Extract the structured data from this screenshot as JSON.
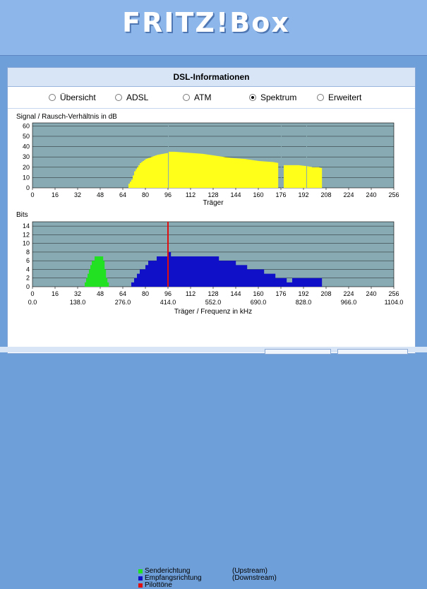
{
  "brand": {
    "logo_text": "FRITZ!Box"
  },
  "page": {
    "title": "DSL-Informationen"
  },
  "tabs": [
    {
      "label": "Übersicht",
      "selected": false
    },
    {
      "label": "ADSL",
      "selected": false
    },
    {
      "label": "ATM",
      "selected": false
    },
    {
      "label": "Spektrum",
      "selected": true
    },
    {
      "label": "Erweitert",
      "selected": false
    }
  ],
  "legend": {
    "rows": [
      {
        "label": "Senderichtung",
        "dir": "(Upstream)",
        "color": "#22e022"
      },
      {
        "label": "Empfangsrichtung",
        "dir": "(Downstream)",
        "color": "#1010c8"
      },
      {
        "label": "Pilottöne",
        "dir": "",
        "color": "#e01010"
      }
    ]
  },
  "chart_data": [
    {
      "type": "bar",
      "title": "Signal / Rausch-Verhältnis in dB",
      "xlabel": "Träger",
      "ylabel": "",
      "xlim": [
        0,
        256
      ],
      "ylim": [
        0,
        63
      ],
      "x_ticks": [
        0,
        16,
        32,
        48,
        64,
        80,
        96,
        112,
        128,
        144,
        160,
        176,
        192,
        208,
        224,
        240,
        256
      ],
      "y_ticks": [
        0,
        10,
        20,
        30,
        40,
        50,
        60
      ],
      "grid": true,
      "series": [
        {
          "color": "#ffff1a",
          "segments": [
            {
              "x": [
                68,
                70,
                72,
                74,
                76,
                80,
                84,
                88,
                92,
                96
              ],
              "y": [
                4,
                8,
                16,
                20,
                24,
                28,
                30,
                32,
                33,
                34
              ]
            },
            {
              "x": [
                96,
                100,
                110,
                120,
                130,
                140,
                150,
                160,
                170,
                174
              ],
              "y": [
                35,
                35,
                34,
                33,
                31,
                29,
                28,
                26,
                25,
                24
              ]
            },
            {
              "x": [
                178,
                182,
                188,
                194,
                198,
                202,
                205
              ],
              "y": [
                22,
                22,
                22,
                21,
                20,
                20,
                19
              ]
            }
          ],
          "pilot_gaps": [
            96,
            176,
            194
          ]
        }
      ]
    },
    {
      "type": "bar",
      "title": "Bits",
      "xlabel": "Träger / Frequenz in kHz",
      "ylabel": "",
      "xlim": [
        0,
        256
      ],
      "ylim": [
        0,
        15
      ],
      "x_ticks": [
        0,
        16,
        32,
        48,
        64,
        80,
        96,
        112,
        128,
        144,
        160,
        176,
        192,
        208,
        224,
        240,
        256
      ],
      "x_ticks_secondary": [
        "0.0",
        "138.0",
        "276.0",
        "414.0",
        "552.0",
        "690.0",
        "828.0",
        "966.0",
        "1104.0"
      ],
      "y_ticks": [
        0,
        2,
        4,
        6,
        8,
        10,
        12,
        14
      ],
      "grid": true,
      "series": [
        {
          "name": "Senderichtung",
          "color": "#22e022",
          "bars": [
            [
              37,
              1
            ],
            [
              38,
              2
            ],
            [
              39,
              3
            ],
            [
              40,
              4
            ],
            [
              41,
              5
            ],
            [
              42,
              6
            ],
            [
              43,
              6
            ],
            [
              44,
              7
            ],
            [
              45,
              7
            ],
            [
              46,
              7
            ],
            [
              47,
              7
            ],
            [
              48,
              7
            ],
            [
              49,
              7
            ],
            [
              50,
              6
            ],
            [
              51,
              4
            ],
            [
              52,
              2
            ],
            [
              53,
              1
            ]
          ]
        },
        {
          "name": "Empfangsrichtung",
          "color": "#1010c8",
          "bars": [
            [
              70,
              1
            ],
            [
              72,
              2
            ],
            [
              74,
              3
            ],
            [
              76,
              4
            ],
            [
              78,
              4
            ],
            [
              80,
              5
            ],
            [
              82,
              6
            ],
            [
              84,
              6
            ],
            [
              86,
              6
            ],
            [
              88,
              7
            ],
            [
              90,
              7
            ],
            [
              92,
              7
            ],
            [
              94,
              7
            ],
            [
              96,
              8
            ],
            [
              98,
              7
            ],
            [
              100,
              7
            ],
            [
              104,
              7
            ],
            [
              108,
              7
            ],
            [
              112,
              7
            ],
            [
              116,
              7
            ],
            [
              120,
              7
            ],
            [
              124,
              7
            ],
            [
              128,
              7
            ],
            [
              132,
              6
            ],
            [
              136,
              6
            ],
            [
              140,
              6
            ],
            [
              144,
              5
            ],
            [
              148,
              5
            ],
            [
              152,
              4
            ],
            [
              156,
              4
            ],
            [
              160,
              4
            ],
            [
              164,
              3
            ],
            [
              168,
              3
            ],
            [
              172,
              2
            ],
            [
              176,
              2
            ],
            [
              180,
              1
            ],
            [
              184,
              2
            ],
            [
              188,
              2
            ],
            [
              192,
              2
            ],
            [
              196,
              2
            ],
            [
              200,
              2
            ],
            [
              204,
              2
            ]
          ]
        },
        {
          "name": "Pilottöne",
          "color": "#e01010",
          "pilot_carrier": 96
        }
      ]
    }
  ]
}
